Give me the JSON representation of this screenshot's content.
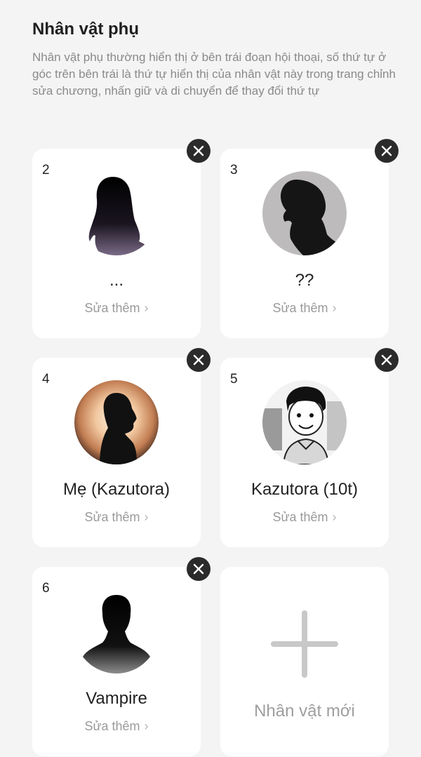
{
  "header": {
    "title": "Nhân vật phụ",
    "description": "Nhân vật phụ thường hiển thị ở bên trái đoạn hội thoại, số thứ tự ở góc trên bên trái là thứ tự hiển thị của nhân vật này trong trang chỉnh sửa chương, nhấn giữ và di chuyển để thay đổi thứ tự"
  },
  "characters": [
    {
      "index": "2",
      "name": "...",
      "edit_label": "Sửa thêm",
      "chevron": "›"
    },
    {
      "index": "3",
      "name": "??",
      "edit_label": "Sửa thêm",
      "chevron": "›"
    },
    {
      "index": "4",
      "name": "Mẹ (Kazutora)",
      "edit_label": "Sửa thêm",
      "chevron": "›"
    },
    {
      "index": "5",
      "name": "Kazutora (10t)",
      "edit_label": "Sửa thêm",
      "chevron": "›"
    },
    {
      "index": "6",
      "name": "Vampire",
      "edit_label": "Sửa thêm",
      "chevron": "›"
    }
  ],
  "add_card": {
    "label": "Nhân vật mới",
    "icon": "plus-icon"
  },
  "icons": {
    "close": "close-icon"
  },
  "colors": {
    "close_bg": "#2b2b2b",
    "card_bg": "#ffffff",
    "page_bg": "#f4f4f4"
  }
}
